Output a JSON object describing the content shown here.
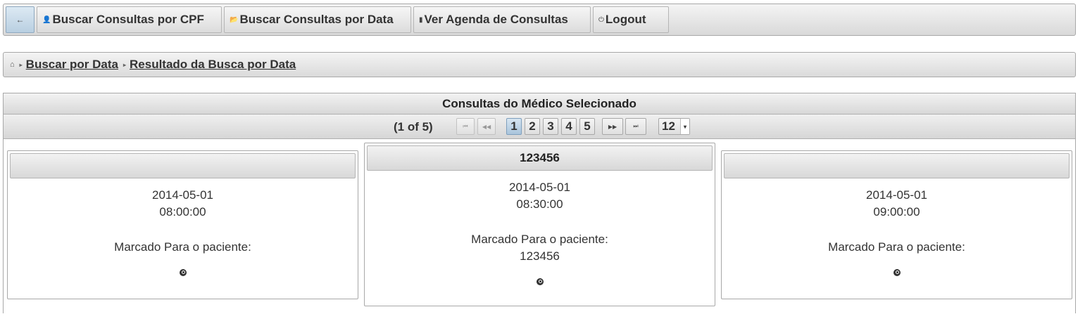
{
  "menubar": {
    "back_icon": "←",
    "items": [
      {
        "label": "Buscar Consultas por CPF",
        "icon": "👤"
      },
      {
        "label": "Buscar Consultas por Data",
        "icon": "📂"
      },
      {
        "label": "Ver Agenda de Consultas",
        "icon": "▮"
      },
      {
        "label": "Logout",
        "icon": "⏻"
      }
    ]
  },
  "breadcrumb": {
    "home_icon": "⌂",
    "separator": "▸",
    "items": [
      "Buscar por Data",
      "Resultado da Busca por Data"
    ]
  },
  "panel": {
    "title": "Consultas do Médico Selecionado",
    "paginator": {
      "status": "(1 of 5)",
      "first_icon": "⏮",
      "prev_icon": "◀◀",
      "next_icon": "▶▶",
      "last_icon": "⏭",
      "pages": [
        "1",
        "2",
        "3",
        "4",
        "5"
      ],
      "active_page": "1",
      "rows_per_page": "12",
      "dropdown_icon": "▾"
    }
  },
  "cards": [
    {
      "header": "",
      "date": "2014-05-01",
      "time": "08:00:00",
      "label": "Marcado Para o paciente:",
      "patient": ""
    },
    {
      "header": "123456",
      "date": "2014-05-01",
      "time": "08:30:00",
      "label": "Marcado Para o paciente:",
      "patient": "123456"
    },
    {
      "header": "",
      "date": "2014-05-01",
      "time": "09:00:00",
      "label": "Marcado Para o paciente:",
      "patient": ""
    }
  ],
  "colors": {
    "active_accent": "#b9cfe1",
    "border": "#a8a8a8"
  }
}
